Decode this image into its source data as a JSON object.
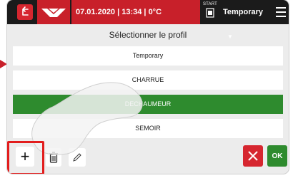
{
  "header": {
    "datetime": "07.01.2020 | 13:34 | 0°C",
    "start_label": "START",
    "current_profile": "Temporary"
  },
  "page": {
    "title": "Sélectionner le profil"
  },
  "profiles": [
    {
      "label": "Temporary",
      "selected": false
    },
    {
      "label": "CHARRUE",
      "selected": false
    },
    {
      "label": "DECHAUMEUR",
      "selected": true
    },
    {
      "label": "SEMOIR",
      "selected": false
    }
  ],
  "actions": {
    "add_label": "+",
    "ok_label": "OK"
  },
  "colors": {
    "brand_red": "#c8202a",
    "selected_green": "#2e8b2e",
    "highlight_red": "#e21d1d"
  },
  "icons": [
    "back-arrow-icon",
    "logo-icon",
    "start-icon",
    "chevron-down-icon",
    "menu-icon",
    "trash-icon",
    "pencil-icon",
    "close-icon",
    "hand-pointer-icon"
  ]
}
